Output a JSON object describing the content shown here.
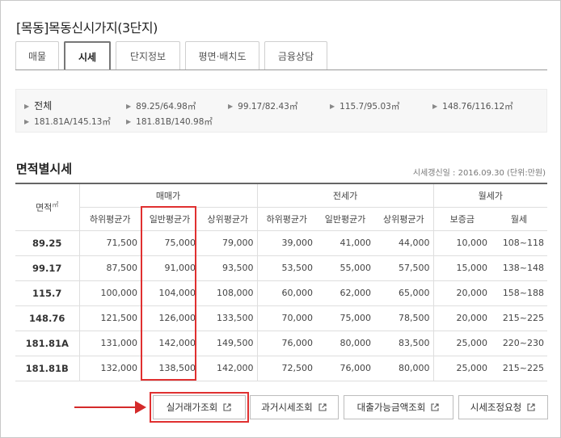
{
  "title": "[목동]목동신시가지(3단지)",
  "tabs": [
    {
      "label": "매물",
      "active": false
    },
    {
      "label": "시세",
      "active": true
    },
    {
      "label": "단지정보",
      "active": false
    },
    {
      "label": "평면·배치도",
      "active": false
    },
    {
      "label": "금융상담",
      "active": false
    }
  ],
  "area_filters": {
    "all": "전체",
    "items": [
      "89.25/64.98㎡",
      "99.17/82.43㎡",
      "115.7/95.03㎡",
      "148.76/116.12㎡",
      "181.81A/145.13㎡",
      "181.81B/140.98㎡"
    ]
  },
  "section": {
    "title": "면적별시세",
    "meta": "시세갱신일 : 2016.09.30 (단위:만원)"
  },
  "table": {
    "area_header": "면적",
    "area_unit": "㎡",
    "groups": [
      "매매가",
      "전세가",
      "월세가"
    ],
    "columns": [
      "하위평균가",
      "일반평균가",
      "상위평균가",
      "하위평균가",
      "일반평균가",
      "상위평균가",
      "보증금",
      "월세"
    ],
    "rows": [
      {
        "area": "89.25",
        "cells": [
          "71,500",
          "75,000",
          "79,000",
          "39,000",
          "41,000",
          "44,000",
          "10,000",
          "108~118"
        ]
      },
      {
        "area": "99.17",
        "cells": [
          "87,500",
          "91,000",
          "93,500",
          "53,500",
          "55,000",
          "57,500",
          "15,000",
          "138~148"
        ]
      },
      {
        "area": "115.7",
        "cells": [
          "100,000",
          "104,000",
          "108,000",
          "60,000",
          "62,000",
          "65,000",
          "20,000",
          "158~188"
        ]
      },
      {
        "area": "148.76",
        "cells": [
          "121,500",
          "126,000",
          "133,500",
          "70,000",
          "75,000",
          "78,500",
          "20,000",
          "215~225"
        ]
      },
      {
        "area": "181.81A",
        "cells": [
          "131,000",
          "142,000",
          "149,500",
          "76,000",
          "80,000",
          "83,500",
          "25,000",
          "220~230"
        ]
      },
      {
        "area": "181.81B",
        "cells": [
          "132,000",
          "138,500",
          "142,000",
          "72,500",
          "76,000",
          "80,000",
          "25,000",
          "215~225"
        ]
      }
    ]
  },
  "buttons": [
    "실거래가조회",
    "과거시세조회",
    "대출가능금액조회",
    "시세조정요청"
  ],
  "colors": {
    "highlight": "#e03030",
    "arrow": "#d42a2a"
  },
  "icons": {
    "area_arrow": "triangle-right-icon",
    "button_external": "external-link-icon"
  }
}
